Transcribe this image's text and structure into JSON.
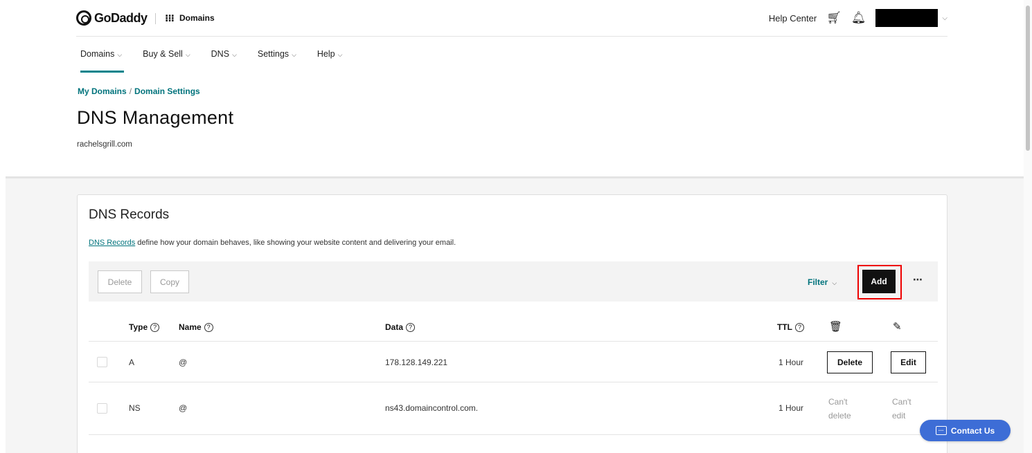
{
  "header": {
    "brand": "GoDaddy",
    "apps_label": "Domains",
    "help_center": "Help Center"
  },
  "nav": {
    "items": [
      {
        "label": "Domains",
        "active": true
      },
      {
        "label": "Buy & Sell"
      },
      {
        "label": "DNS"
      },
      {
        "label": "Settings"
      },
      {
        "label": "Help"
      }
    ]
  },
  "breadcrumb": {
    "items": [
      "My Domains",
      "Domain Settings"
    ],
    "separator": "/"
  },
  "page": {
    "title": "DNS Management",
    "domain": "rachelsgrill.com"
  },
  "dns_records": {
    "title": "DNS Records",
    "desc_link": "DNS Records",
    "desc_text": " define how your domain behaves, like showing your website content and delivering your email.",
    "toolbar": {
      "delete": "Delete",
      "copy": "Copy",
      "filter": "Filter",
      "add": "Add",
      "more": "⋯"
    },
    "columns": {
      "type": "Type",
      "name": "Name",
      "data": "Data",
      "ttl": "TTL"
    },
    "rows": [
      {
        "type": "A",
        "name": "@",
        "data": "178.128.149.221",
        "ttl": "1 Hour",
        "delete": "Delete",
        "edit": "Edit"
      },
      {
        "type": "NS",
        "name": "@",
        "data": "ns43.domaincontrol.com.",
        "ttl": "1 Hour",
        "delete": "Can't delete",
        "edit": "Can't edit"
      }
    ]
  },
  "contact": {
    "label": "Contact Us"
  },
  "colors": {
    "teal_accent": "#00737c",
    "contact_blue": "#3d6dd6",
    "highlight_red": "#e00000"
  }
}
